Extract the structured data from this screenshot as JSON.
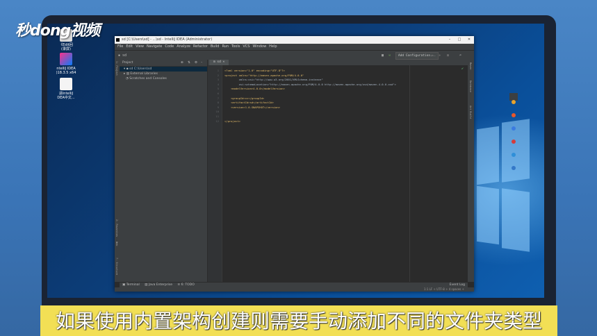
{
  "watermark": "秒dong视频",
  "desktop_icons": [
    {
      "label": "《Edit回\n(录屏)"
    },
    {
      "label": "ntelliJ IDEA\n)18.3.5 x64"
    },
    {
      "label": "进IntelliJ\nDEA中文..."
    }
  ],
  "ide": {
    "window_title": "sd [C:\\Users\\sd] - ...\\sd - IntelliJ IDEA (Administrator)",
    "menu": [
      "File",
      "Edit",
      "View",
      "Navigate",
      "Code",
      "Analyze",
      "Refactor",
      "Build",
      "Run",
      "Tools",
      "VCS",
      "Window",
      "Help"
    ],
    "project_name": "sd",
    "add_configuration": "Add Configuration...",
    "project_panel_title": "Project",
    "tree": [
      "sd C:\\Users\\sd",
      "External Libraries",
      "Scratches and Consoles"
    ],
    "editor_tab": "sd",
    "line_numbers": [
      "1",
      "2",
      "3",
      "4",
      "5",
      "6",
      "7",
      "8",
      "9",
      "10",
      "11",
      "12"
    ],
    "code_lines": [
      "<?xml version=\"1.0\" encoding=\"UTF-8\"?>",
      "<project xmlns=\"http://maven.apache.org/POM/4.0.0\"",
      "         xmlns:xsi=\"http://www.w3.org/2001/XMLSchema-instance\"",
      "         xsi:schemaLocation=\"http://maven.apache.org/POM/4.0.0 http://maven.apache.org/xsd/maven-4.0.0.xsd\">",
      "    <modelVersion>4.0.0</modelVersion>",
      "",
      "    <groupId>cc</groupId>",
      "    <artifactId>sd</artifactId>",
      "    <version>1.0-SNAPSHOT</version>",
      "",
      "",
      "</project>"
    ],
    "left_tabs": [
      "1: Project",
      "2: Favorites",
      "Web",
      "7: Structure"
    ],
    "right_tabs": [
      "Maven",
      "Database",
      "Ant Build"
    ],
    "bottom_tabs": [
      "Terminal",
      "Java Enterprise",
      "6: TODO"
    ],
    "event_log": "Event Log",
    "status_right": "1:1  LF ÷  UTF-8 ÷  4 spaces ÷"
  },
  "subtitle": "如果使用内置架构创建则需要手动添加不同的文件夹类型",
  "colors": {
    "accent": "#f2df55",
    "editor_bg": "#2b2b2b",
    "panel_bg": "#3c3f41"
  }
}
